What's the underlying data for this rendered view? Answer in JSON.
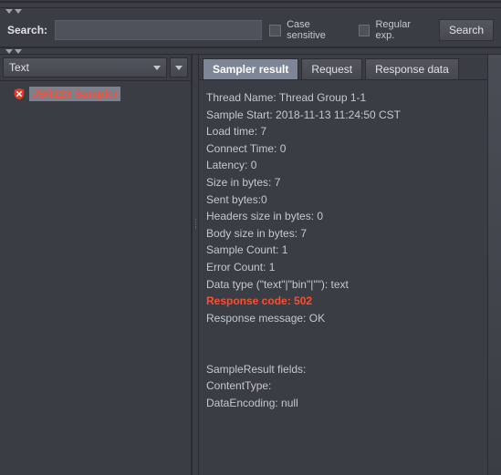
{
  "search": {
    "label": "Search:",
    "value": "",
    "caseSensitive": "Case sensitive",
    "regularExp": "Regular exp.",
    "button": "Search"
  },
  "filterCombo": {
    "value": "Text"
  },
  "tree": {
    "items": [
      {
        "label": "JSR223 Sampler"
      }
    ]
  },
  "tabs": {
    "active": 0,
    "items": [
      {
        "label": "Sampler result"
      },
      {
        "label": "Request"
      },
      {
        "label": "Response data"
      }
    ]
  },
  "result": {
    "lines": [
      {
        "text": "Thread Name: Thread Group 1-1"
      },
      {
        "text": "Sample Start: 2018-11-13 11:24:50 CST"
      },
      {
        "text": "Load time: 7"
      },
      {
        "text": "Connect Time: 0"
      },
      {
        "text": "Latency: 0"
      },
      {
        "text": "Size in bytes: 7"
      },
      {
        "text": "Sent bytes:0"
      },
      {
        "text": "Headers size in bytes: 0"
      },
      {
        "text": "Body size in bytes: 7"
      },
      {
        "text": "Sample Count: 1"
      },
      {
        "text": "Error Count: 1"
      },
      {
        "text": "Data type (\"text\"|\"bin\"|\"\"): text"
      },
      {
        "text": "Response code: 502",
        "red": true
      },
      {
        "text": "Response message: OK"
      },
      {
        "text": ""
      },
      {
        "text": ""
      },
      {
        "text": "SampleResult fields:"
      },
      {
        "text": "ContentType:"
      },
      {
        "text": "DataEncoding: null"
      }
    ]
  }
}
